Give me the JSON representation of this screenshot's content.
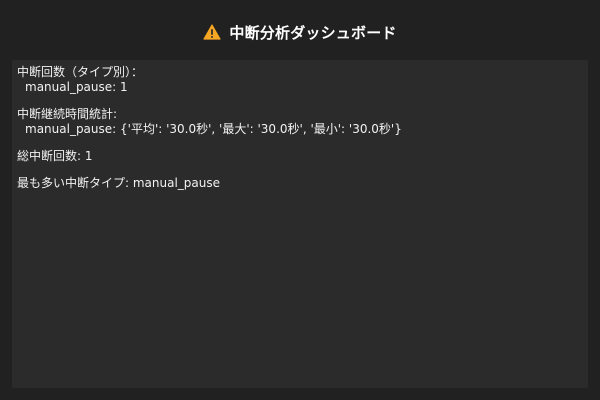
{
  "header": {
    "icon": "warning-icon",
    "title": "中断分析ダッシュボード"
  },
  "panel": {
    "counts_by_type_heading": "中断回数（タイプ別）：",
    "counts_by_type_items": [
      "manual_pause: 1"
    ],
    "duration_stats_heading": "中断継続時間統計:",
    "duration_stats_items": [
      "manual_pause: {'平均': '30.0秒', '最大': '30.0秒', '最小': '30.0秒'}"
    ],
    "total_count": "総中断回数: 1",
    "most_common_type": "最も多い中断タイプ: manual_pause"
  },
  "colors": {
    "background": "#212121",
    "panel": "#2b2b2b",
    "warning": "#f5a623",
    "text": "#f2f2f2"
  }
}
